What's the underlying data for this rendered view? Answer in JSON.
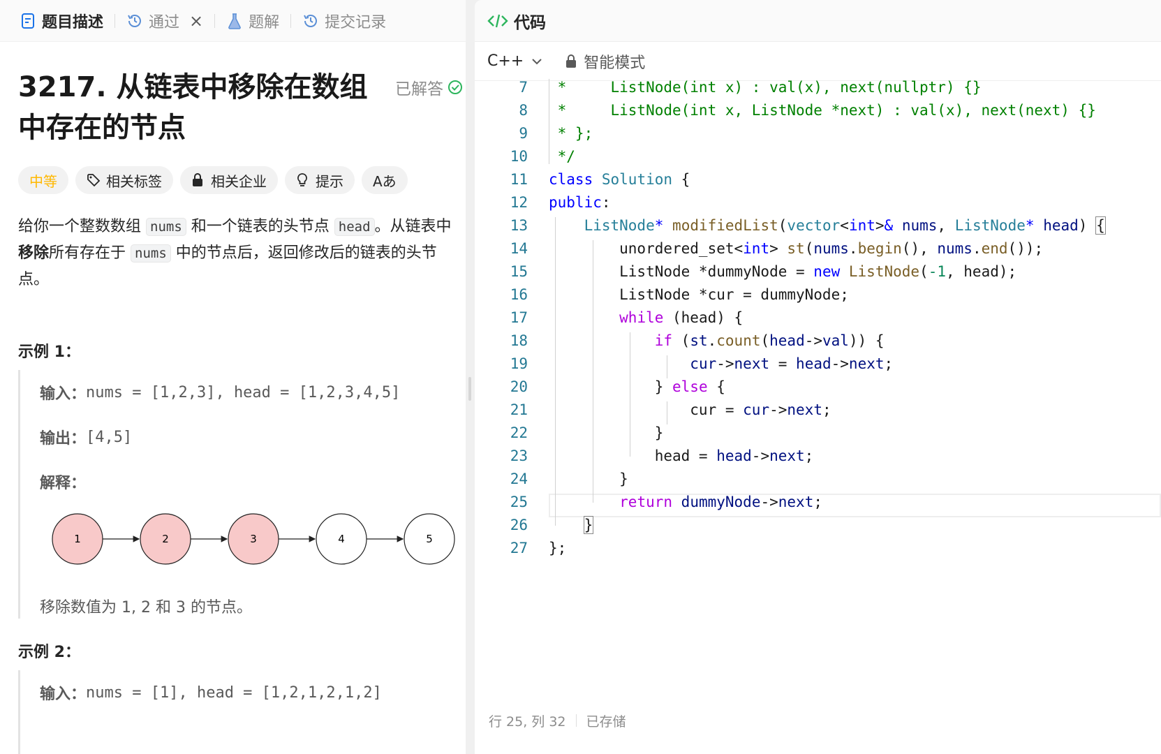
{
  "tabs": [
    {
      "label": "题目描述",
      "icon": "document-icon"
    },
    {
      "label": "通过",
      "icon": "history-icon"
    },
    {
      "label": "题解",
      "icon": "flask-icon"
    },
    {
      "label": "提交记录",
      "icon": "history-icon"
    }
  ],
  "problem": {
    "title_line1": "3217. 从链表中移除在数组",
    "title_line2": "中存在的节点",
    "status": "已解答",
    "tags": [
      "中等",
      "相关标签",
      "相关企业",
      "提示",
      "Aあ"
    ],
    "desc": {
      "p1": "给你一个整数数组 ",
      "c1": "nums",
      "p2": " 和一个链表的头节点 ",
      "c2": "head",
      "p3": "。从链表中",
      "b1": "移除",
      "p4": "所有存在于 ",
      "c3": "nums",
      "p5": " 中的节点后，返回修改后的链表的头节点。"
    },
    "example1": {
      "title": "示例 1：",
      "input_label": "输入：",
      "input": "nums = [1,2,3], head = [1,2,3,4,5]",
      "output_label": "输出：",
      "output": "[4,5]",
      "explain_label": "解释：",
      "nodes": [
        "1",
        "2",
        "3",
        "4",
        "5"
      ],
      "removed_color": "#f8c9c9",
      "note": "移除数值为 1, 2 和 3 的节点。"
    },
    "example2": {
      "title": "示例 2：",
      "input_label": "输入：",
      "input": "nums = [1], head = [1,2,1,2,1,2]"
    }
  },
  "code_panel": {
    "title": "代码",
    "language": "C++",
    "mode": "智能模式",
    "status_position": "行 25, 列 32",
    "status_saved": "已存储",
    "line_numbers": [
      "7",
      "8",
      "9",
      "10",
      "11",
      "12",
      "13",
      "14",
      "15",
      "16",
      "17",
      "18",
      "19",
      "20",
      "21",
      "22",
      "23",
      "24",
      "25",
      "26",
      "27"
    ]
  }
}
